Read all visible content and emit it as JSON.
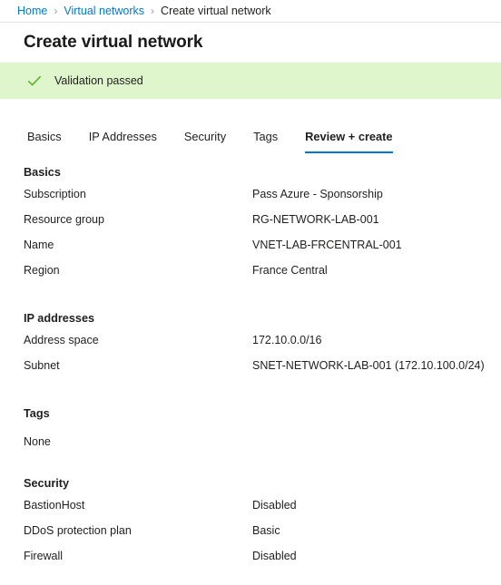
{
  "breadcrumb": {
    "items": [
      {
        "label": "Home",
        "link": true
      },
      {
        "label": "Virtual networks",
        "link": true
      },
      {
        "label": "Create virtual network",
        "link": false
      }
    ],
    "separator": "›"
  },
  "header": {
    "title": "Create virtual network"
  },
  "validation": {
    "icon": "checkmark-icon",
    "message": "Validation passed",
    "background_color": "#dff6cd",
    "icon_color": "#5db82d"
  },
  "tabs": {
    "items": [
      {
        "label": "Basics",
        "active": false
      },
      {
        "label": "IP Addresses",
        "active": false
      },
      {
        "label": "Security",
        "active": false
      },
      {
        "label": "Tags",
        "active": false
      },
      {
        "label": "Review + create",
        "active": true
      }
    ],
    "accent_color": "#0078d4"
  },
  "review": {
    "sections": [
      {
        "heading": "Basics",
        "rows": [
          {
            "label": "Subscription",
            "value": "Pass Azure - Sponsorship"
          },
          {
            "label": "Resource group",
            "value": "RG-NETWORK-LAB-001"
          },
          {
            "label": "Name",
            "value": "VNET-LAB-FRCENTRAL-001"
          },
          {
            "label": "Region",
            "value": "France Central"
          }
        ]
      },
      {
        "heading": "IP addresses",
        "rows": [
          {
            "label": "Address space",
            "value": "172.10.0.0/16"
          },
          {
            "label": "Subnet",
            "value": "SNET-NETWORK-LAB-001 (172.10.100.0/24)"
          }
        ]
      },
      {
        "heading": "Tags",
        "text": "None",
        "rows": []
      },
      {
        "heading": "Security",
        "rows": [
          {
            "label": "BastionHost",
            "value": "Disabled"
          },
          {
            "label": "DDoS protection plan",
            "value": "Basic"
          },
          {
            "label": "Firewall",
            "value": "Disabled"
          }
        ]
      }
    ]
  }
}
